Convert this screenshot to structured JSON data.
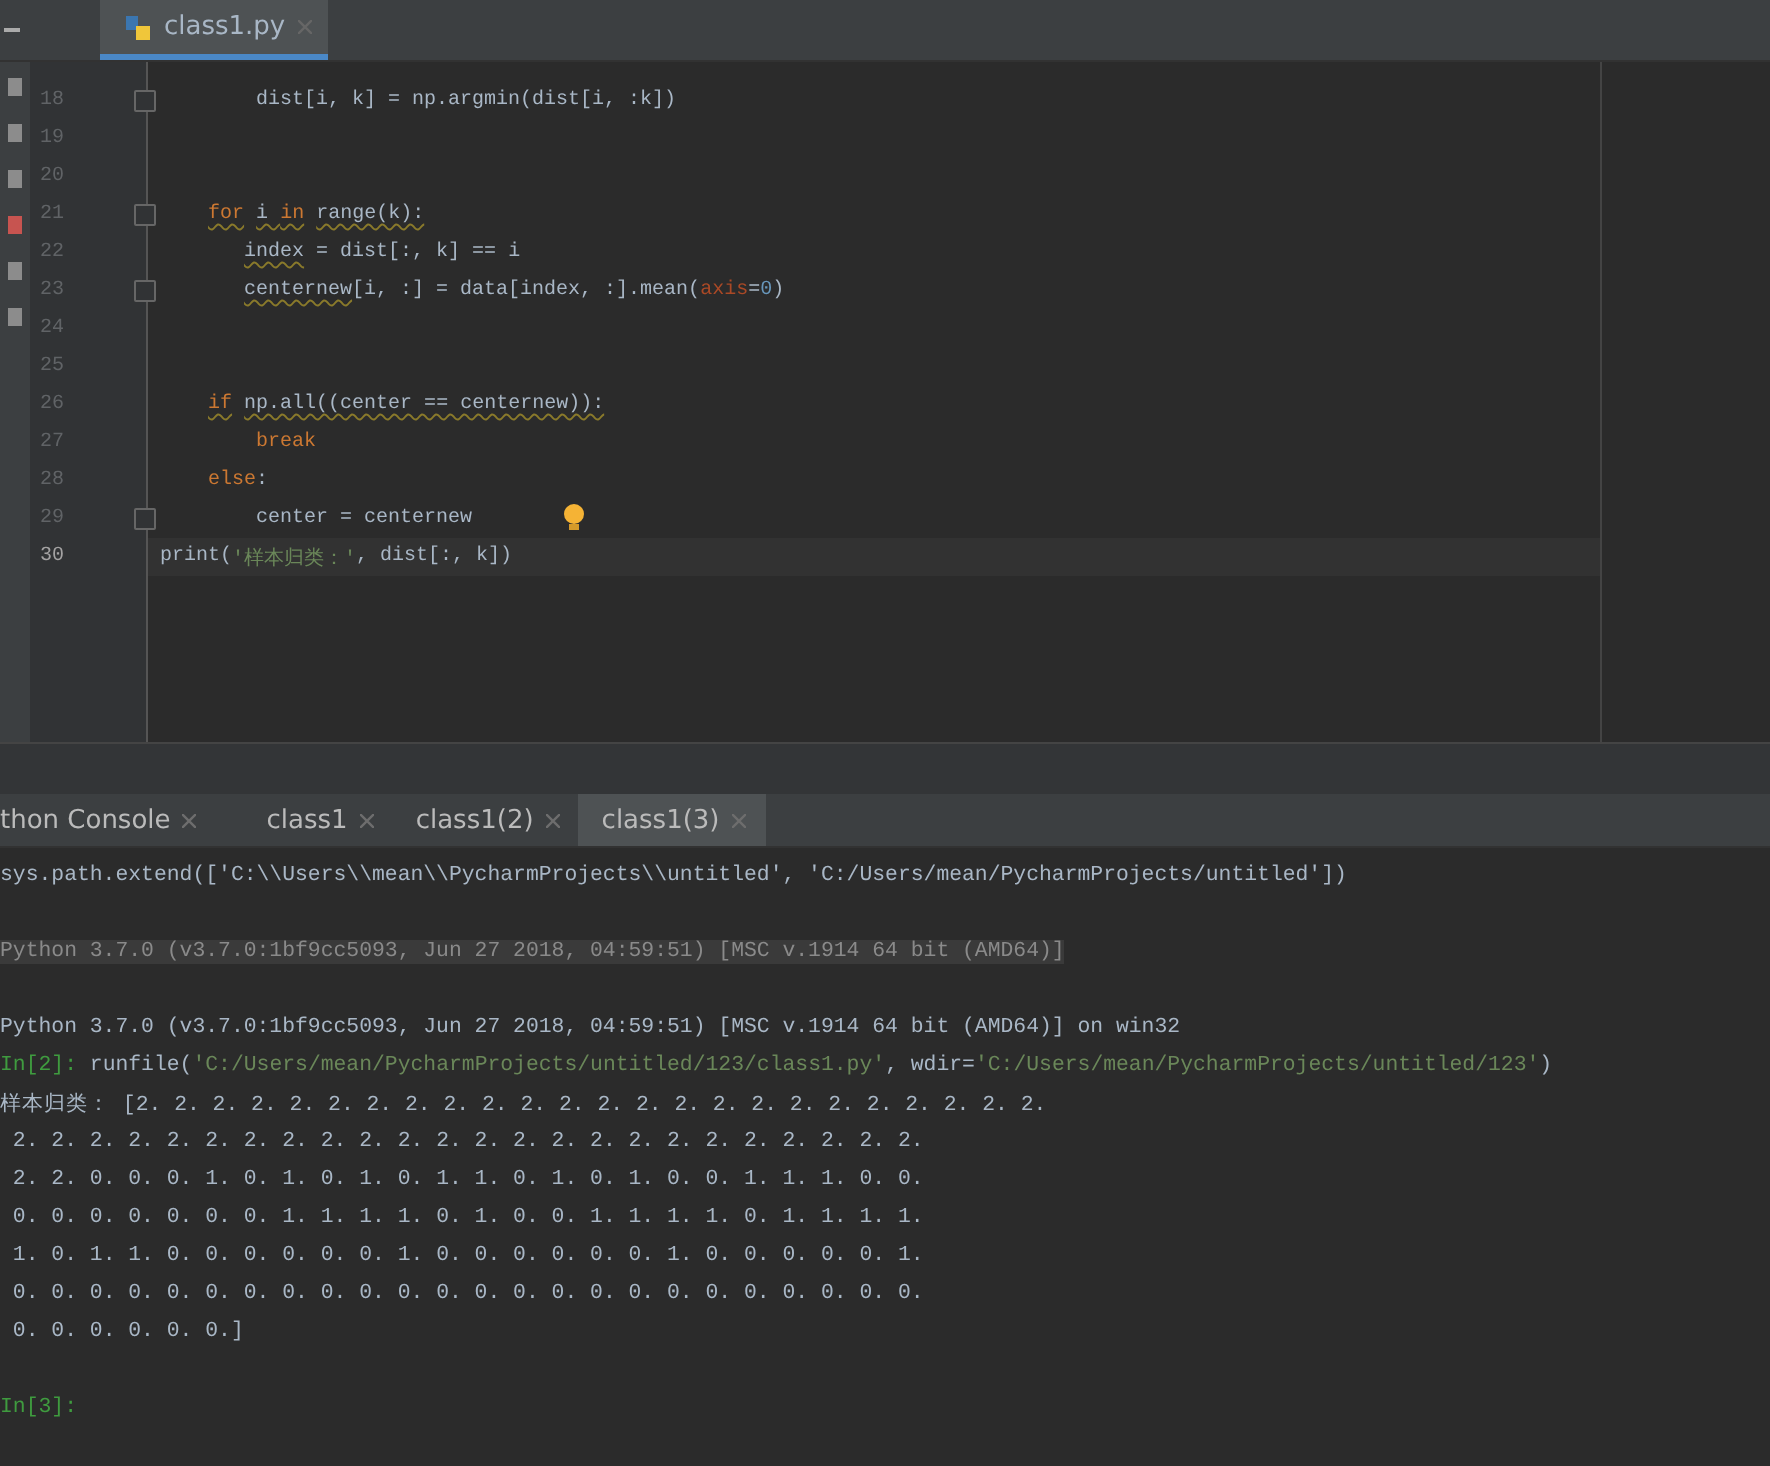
{
  "editor_tabs": [
    {
      "label": "class1.py",
      "selected": true
    }
  ],
  "editor": {
    "lines": [
      {
        "number": "18",
        "current": false,
        "fold": true,
        "hint": false,
        "segments": [
          {
            "text": "        dist[i, k] = np.argmin(dist[i, :k])",
            "kind": "text"
          }
        ]
      },
      {
        "number": "19",
        "current": false,
        "fold": false,
        "hint": false
      },
      {
        "number": "20",
        "current": false,
        "fold": false,
        "hint": false
      },
      {
        "number": "21",
        "current": false,
        "fold": true,
        "hint": false,
        "segments": [
          {
            "text": "    for",
            "kind": "warnkw"
          },
          {
            "text": " i ",
            "kind": "warned"
          },
          {
            "text": "in",
            "kind": "warnkw"
          },
          {
            "text": " range(k):",
            "kind": "warned"
          }
        ]
      },
      {
        "number": "22",
        "current": false,
        "fold": false,
        "hint": false,
        "segments": [
          {
            "text": "       index",
            "kind": "warned"
          },
          {
            "text": " = dist[:, k] == i",
            "kind": "text"
          }
        ]
      },
      {
        "number": "23",
        "current": false,
        "fold": true,
        "hint": false,
        "segments": [
          {
            "text": "       centernew",
            "kind": "warned"
          },
          {
            "text": "[i, :] = data[index, :].mean(",
            "kind": "text"
          },
          {
            "text": "axis",
            "kind": "param"
          },
          {
            "text": "=",
            "kind": "text"
          },
          {
            "text": "0",
            "kind": "number"
          },
          {
            "text": ")",
            "kind": "text"
          }
        ]
      },
      {
        "number": "24",
        "current": false,
        "fold": false,
        "hint": false
      },
      {
        "number": "25",
        "current": false,
        "fold": false,
        "hint": false
      },
      {
        "number": "26",
        "current": false,
        "fold": false,
        "hint": false,
        "segments": [
          {
            "text": "    if",
            "kind": "warnkw"
          },
          {
            "text": " np.all((center == centernew)):",
            "kind": "warned"
          }
        ]
      },
      {
        "number": "27",
        "current": false,
        "fold": false,
        "hint": false,
        "segments": [
          {
            "text": "        break",
            "kind": "keyword"
          }
        ]
      },
      {
        "number": "28",
        "current": false,
        "fold": false,
        "hint": false,
        "segments": [
          {
            "text": "    else",
            "kind": "keyword"
          },
          {
            "text": ":",
            "kind": "text"
          }
        ]
      },
      {
        "number": "29",
        "current": false,
        "fold": true,
        "hint": true,
        "segments": [
          {
            "text": "        center = centernew",
            "kind": "text"
          }
        ]
      },
      {
        "number": "30",
        "current": true,
        "fold": false,
        "hint": false,
        "segments": [
          {
            "text": "print(",
            "kind": "text"
          },
          {
            "text": "'样本归类：'",
            "kind": "string"
          },
          {
            "text": ", dist[:, k])",
            "kind": "text"
          }
        ]
      }
    ]
  },
  "console": {
    "tabs": [
      {
        "label": "thon Console",
        "selected": false
      },
      {
        "label": "class1",
        "selected": false
      },
      {
        "label": "class1(2)",
        "selected": false
      },
      {
        "label": "class1(3)",
        "selected": true
      }
    ],
    "lines": [
      {
        "kind": "output",
        "segments": [
          {
            "text": "sys.path.extend(['C:\\\\Users\\\\mean\\\\PycharmProjects\\\\untitled', 'C:/Users/mean/PycharmProjects/untitled'])",
            "kind": "text"
          }
        ]
      },
      {
        "kind": "gap"
      },
      {
        "kind": "banner",
        "segments": [
          {
            "text": "Python 3.7.0 (v3.7.0:1bf9cc5093, Jun 27 2018, 04:59:51) [MSC v.1914 64 bit (AMD64)]",
            "kind": "text"
          }
        ]
      },
      {
        "kind": "gap"
      },
      {
        "kind": "output",
        "segments": [
          {
            "text": "Python 3.7.0 (v3.7.0:1bf9cc5093, Jun 27 2018, 04:59:51) [MSC v.1914 64 bit (AMD64)] on win32",
            "kind": "text"
          }
        ]
      },
      {
        "kind": "output",
        "segments": [
          {
            "text": "In[2]:",
            "kind": "prompt"
          },
          {
            "text": " runfile(",
            "kind": "text"
          },
          {
            "text": "'C:/Users/mean/PycharmProjects/untitled/123/class1.py'",
            "kind": "string"
          },
          {
            "text": ", wdir=",
            "kind": "text"
          },
          {
            "text": "'C:/Users/mean/PycharmProjects/untitled/123'",
            "kind": "string"
          },
          {
            "text": ")",
            "kind": "text"
          }
        ]
      },
      {
        "kind": "output",
        "segments": [
          {
            "text": "样本归类： [2. 2. 2. 2. 2. 2. 2. 2. 2. 2. 2. 2. 2. 2. 2. 2. 2. 2. 2. 2. 2. 2. 2. 2.",
            "kind": "text"
          }
        ]
      },
      {
        "kind": "output",
        "segments": [
          {
            "text": " 2. 2. 2. 2. 2. 2. 2. 2. 2. 2. 2. 2. 2. 2. 2. 2. 2. 2. 2. 2. 2. 2. 2. 2.",
            "kind": "text"
          }
        ]
      },
      {
        "kind": "output",
        "segments": [
          {
            "text": " 2. 2. 0. 0. 0. 1. 0. 1. 0. 1. 0. 1. 1. 0. 1. 0. 1. 0. 0. 1. 1. 1. 0. 0.",
            "kind": "text"
          }
        ]
      },
      {
        "kind": "output",
        "segments": [
          {
            "text": " 0. 0. 0. 0. 0. 0. 0. 1. 1. 1. 1. 0. 1. 0. 0. 1. 1. 1. 1. 0. 1. 1. 1. 1.",
            "kind": "text"
          }
        ]
      },
      {
        "kind": "output",
        "segments": [
          {
            "text": " 1. 0. 1. 1. 0. 0. 0. 0. 0. 0. 1. 0. 0. 0. 0. 0. 0. 1. 0. 0. 0. 0. 0. 1.",
            "kind": "text"
          }
        ]
      },
      {
        "kind": "output",
        "segments": [
          {
            "text": " 0. 0. 0. 0. 0. 0. 0. 0. 0. 0. 0. 0. 0. 0. 0. 0. 0. 0. 0. 0. 0. 0. 0. 0.",
            "kind": "text"
          }
        ]
      },
      {
        "kind": "output",
        "segments": [
          {
            "text": " 0. 0. 0. 0. 0. 0.]",
            "kind": "text"
          }
        ]
      },
      {
        "kind": "gap"
      },
      {
        "kind": "output",
        "segments": [
          {
            "text": "In[3]:",
            "kind": "prompt"
          }
        ]
      }
    ]
  }
}
